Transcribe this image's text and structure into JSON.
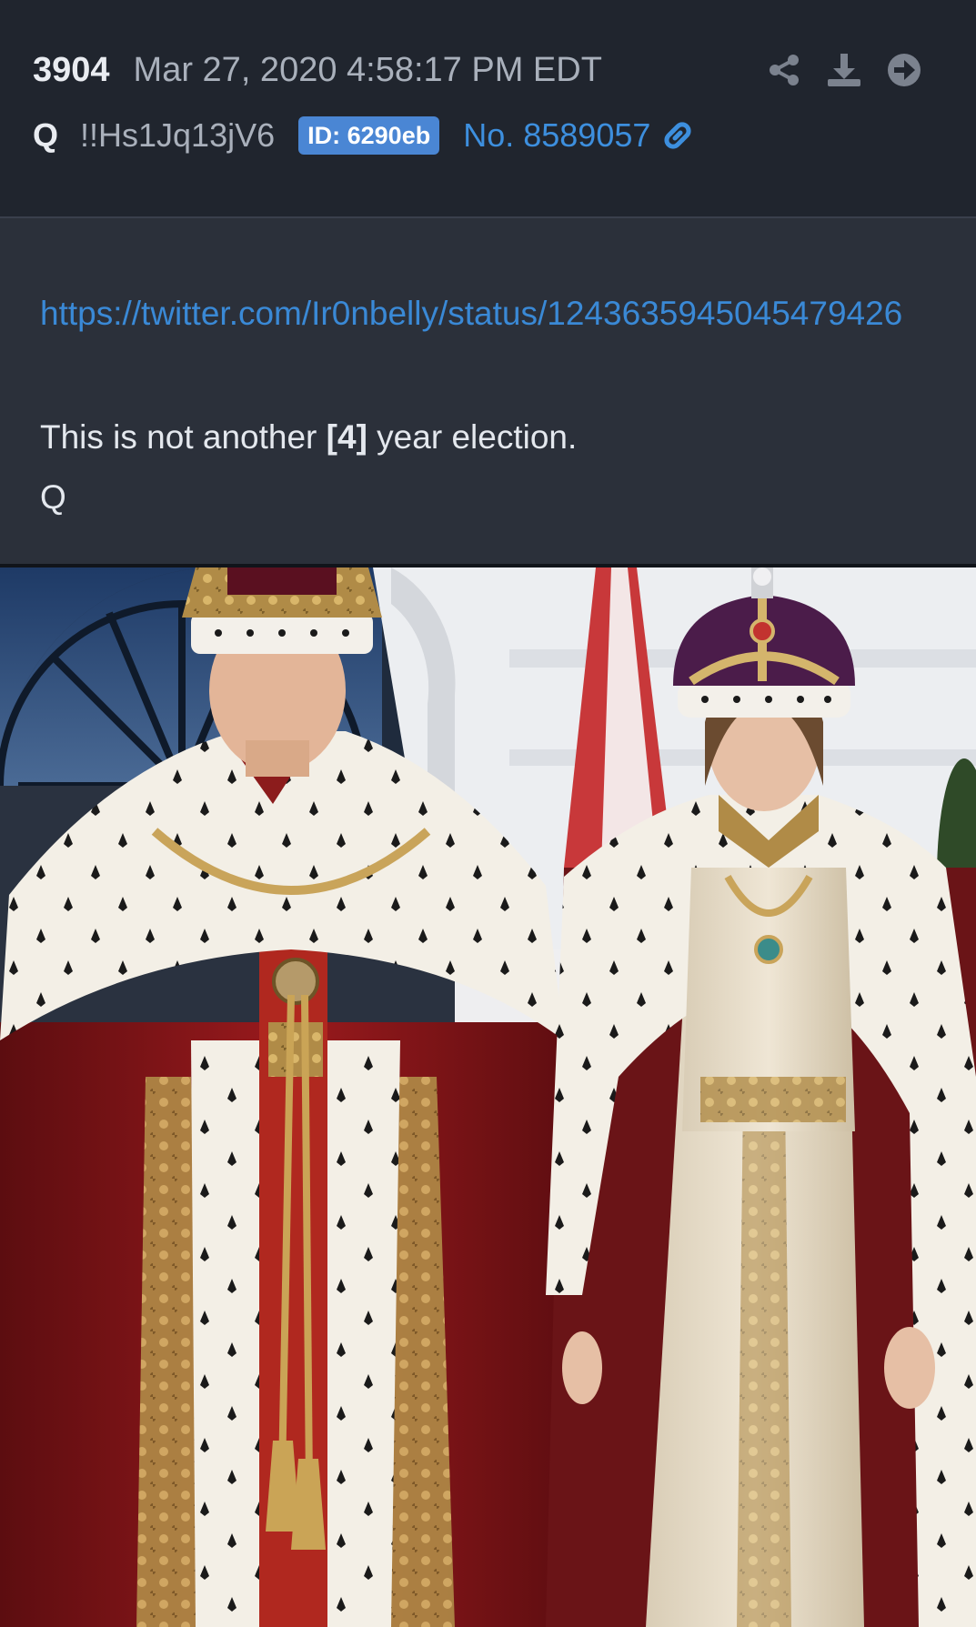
{
  "post": {
    "number": "3904",
    "date": "Mar 27, 2020 4:58:17 PM EDT",
    "author": "Q",
    "tripcode": "!!Hs1Jq13jV6",
    "id_badge": "ID: 6290eb",
    "post_no": "No. 8589057"
  },
  "actions": {
    "share_icon": "share-icon",
    "download_icon": "download-icon",
    "forward_icon": "arrow-circle-right-icon",
    "link_icon": "chain-link-icon"
  },
  "content": {
    "url": "https://twitter.com/Ir0nbelly/status/1243635945045479426",
    "message": "This is not another [4] year election.",
    "message_prefix": "This is not another ",
    "message_bracket": "[4]",
    "message_suffix": " year election.",
    "signature": "Q"
  },
  "colors": {
    "header_bg": "#20252e",
    "body_bg": "#2b303a",
    "link": "#3a89d6",
    "badge": "#4a86d4"
  }
}
